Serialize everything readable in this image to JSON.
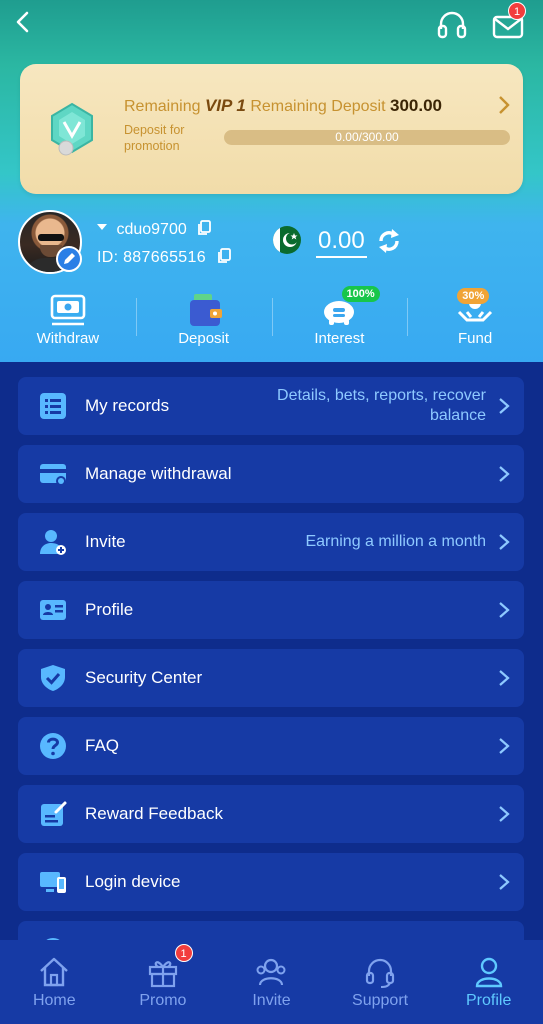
{
  "header": {
    "mail_badge": "1"
  },
  "vip": {
    "remaining_label": "Remaining",
    "level": "VIP 1",
    "remaining_deposit_label": "Remaining Deposit",
    "remaining_deposit": "300.00",
    "subtitle": "Deposit for promotion",
    "progress_text": "0.00/300.00",
    "progress_fraction": 0.0
  },
  "user": {
    "username": "cduo9700",
    "id_label": "ID:",
    "id": "887665516",
    "balance": "0.00"
  },
  "actions": [
    {
      "label": "Withdraw",
      "icon": "withdraw-icon"
    },
    {
      "label": "Deposit",
      "icon": "wallet-icon"
    },
    {
      "label": "Interest",
      "icon": "piggy-bank-icon",
      "tag": "100%"
    },
    {
      "label": "Fund",
      "icon": "hand-coin-icon",
      "tag": "30%"
    }
  ],
  "menu": [
    {
      "label": "My records",
      "hint": "Details, bets, reports, recover balance",
      "icon": "list-icon"
    },
    {
      "label": "Manage withdrawal",
      "hint": "",
      "icon": "card-icon"
    },
    {
      "label": "Invite",
      "hint": "Earning a million a month",
      "icon": "add-user-icon"
    },
    {
      "label": "Profile",
      "hint": "",
      "icon": "id-card-icon"
    },
    {
      "label": "Security Center",
      "hint": "",
      "icon": "shield-icon"
    },
    {
      "label": "FAQ",
      "hint": "",
      "icon": "question-icon"
    },
    {
      "label": "Reward Feedback",
      "hint": "",
      "icon": "edit-note-icon"
    },
    {
      "label": "Login device",
      "hint": "",
      "icon": "devices-icon"
    }
  ],
  "nav": [
    {
      "label": "Home",
      "icon": "home-icon"
    },
    {
      "label": "Promo",
      "icon": "gift-icon",
      "badge": "1"
    },
    {
      "label": "Invite",
      "icon": "people-icon"
    },
    {
      "label": "Support",
      "icon": "headset-icon"
    },
    {
      "label": "Profile",
      "icon": "person-icon",
      "active": true
    }
  ],
  "colors": {
    "menu_bg": "#0e2c8c",
    "row_bg": "#163aa5",
    "accent": "#5fc9ff",
    "vip_gold": "#c79230",
    "badge_red": "#f23d3d"
  }
}
